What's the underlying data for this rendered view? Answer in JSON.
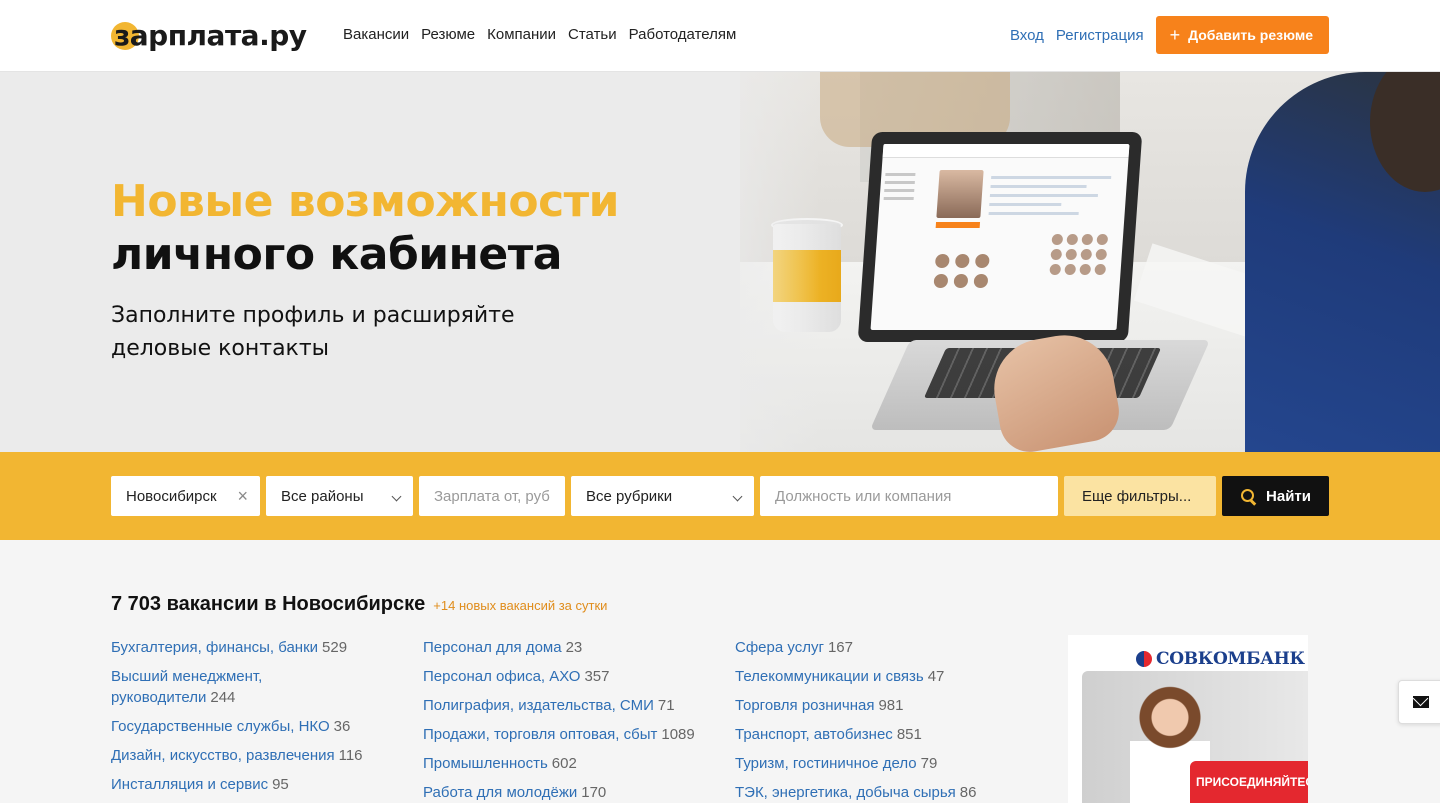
{
  "header": {
    "logo_text": "зарплата.ру",
    "nav": [
      "Вакансии",
      "Резюме",
      "Компании",
      "Статьи",
      "Работодателям"
    ],
    "login": "Вход",
    "register": "Регистрация",
    "add_resume": "Добавить резюме",
    "add_resume_icon": "plus-icon"
  },
  "hero": {
    "title_line1": "Новые возможности",
    "title_line2": "личного кабинета",
    "subtitle": "Заполните профиль и расширяйте деловые контакты"
  },
  "search": {
    "city": "Новосибирск",
    "district": "Все районы",
    "salary_placeholder": "Зарплата от, руб",
    "rubric": "Все рубрики",
    "position_placeholder": "Должность или компания",
    "more_filters": "Еще фильтры...",
    "find": "Найти"
  },
  "vacancies": {
    "title": "7 703 вакансии в Новосибирске",
    "new_count": "+14 новых вакансий за сутки",
    "columns": [
      [
        {
          "label": "Бухгалтерия, финансы, банки",
          "count": "529"
        },
        {
          "label": "Высший менеджмент, руководители",
          "count": "244"
        },
        {
          "label": "Государственные службы, НКО",
          "count": "36"
        },
        {
          "label": "Дизайн, искусство, развлечения",
          "count": "116"
        },
        {
          "label": "Инсталляция и сервис",
          "count": "95"
        }
      ],
      [
        {
          "label": "Персонал для дома",
          "count": "23"
        },
        {
          "label": "Персонал офиса, АХО",
          "count": "357"
        },
        {
          "label": "Полиграфия, издательства, СМИ",
          "count": "71"
        },
        {
          "label": "Продажи, торговля оптовая, сбыт",
          "count": "1089"
        },
        {
          "label": "Промышленность",
          "count": "602"
        },
        {
          "label": "Работа для молодёжи",
          "count": "170"
        }
      ],
      [
        {
          "label": "Сфера услуг",
          "count": "167"
        },
        {
          "label": "Телекоммуникации и связь",
          "count": "47"
        },
        {
          "label": "Торговля розничная",
          "count": "981"
        },
        {
          "label": "Транспорт, автобизнес",
          "count": "851"
        },
        {
          "label": "Туризм, гостиничное дело",
          "count": "79"
        },
        {
          "label": "ТЭК, энергетика, добыча сырья",
          "count": "86"
        }
      ]
    ]
  },
  "ad": {
    "brand": "СОВКОМБАНК",
    "cta": "ПРИСОЕДИНЯЙТЕСЬ"
  },
  "colors": {
    "accent_yellow": "#f2b632",
    "accent_orange": "#f7821b",
    "link_blue": "#2f6fb5"
  }
}
